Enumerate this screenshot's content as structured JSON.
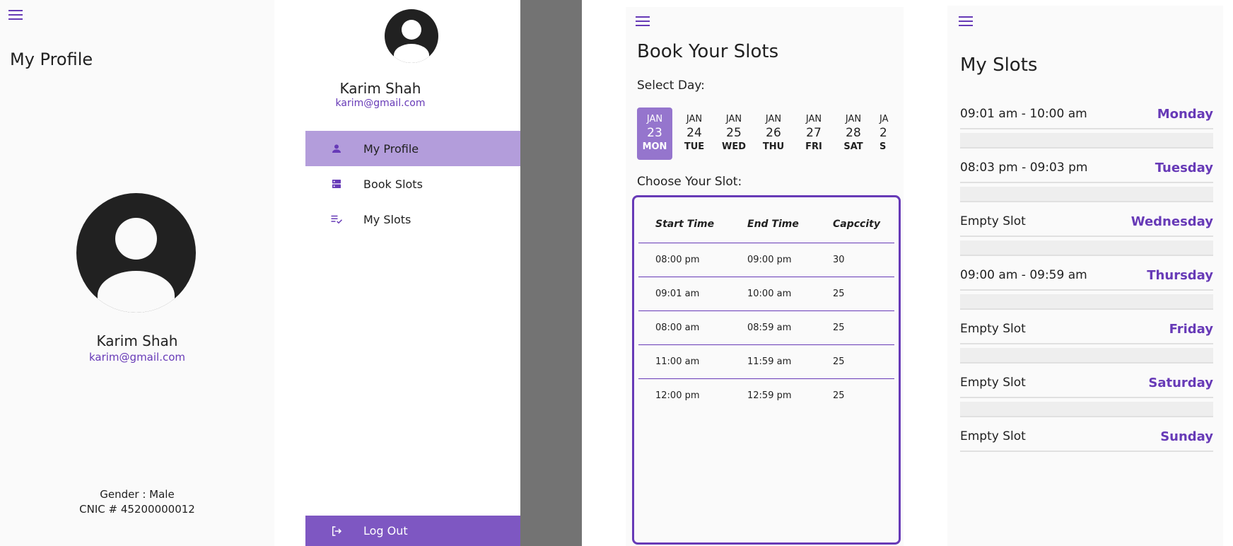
{
  "profile": {
    "title": "My Profile",
    "name": "Karim Shah",
    "email": "karim@gmail.com",
    "gender": "Gender : Male",
    "cnic": "CNIC # 45200000012"
  },
  "drawer": {
    "name": "Karim Shah",
    "email": "karim@gmail.com",
    "items": [
      {
        "label": "My Profile",
        "icon": "person-icon",
        "active": true
      },
      {
        "label": "Book Slots",
        "icon": "dns-icon",
        "active": false
      },
      {
        "label": "My Slots",
        "icon": "playlist-check-icon",
        "active": false
      }
    ],
    "logout": "Log Out"
  },
  "book": {
    "title": "Book Your Slots",
    "select_day": "Select Day:",
    "choose_slot": "Choose Your Slot:",
    "days": [
      {
        "month": "JAN",
        "date": "23",
        "weekday": "MON",
        "selected": true
      },
      {
        "month": "JAN",
        "date": "24",
        "weekday": "TUE"
      },
      {
        "month": "JAN",
        "date": "25",
        "weekday": "WED"
      },
      {
        "month": "JAN",
        "date": "26",
        "weekday": "THU"
      },
      {
        "month": "JAN",
        "date": "27",
        "weekday": "FRI"
      },
      {
        "month": "JAN",
        "date": "28",
        "weekday": "SAT"
      },
      {
        "month": "JA",
        "date": "2",
        "weekday": "S"
      }
    ],
    "columns": [
      "Start Time",
      "End Time",
      "Capccity"
    ],
    "rows": [
      [
        "08:00 pm",
        "09:00 pm",
        "30"
      ],
      [
        "09:01 am",
        "10:00 am",
        "25"
      ],
      [
        "08:00 am",
        "08:59 am",
        "25"
      ],
      [
        "11:00 am",
        "11:59 am",
        "25"
      ],
      [
        "12:00 pm",
        "12:59 pm",
        "25"
      ]
    ]
  },
  "myslots": {
    "title": "My Slots",
    "items": [
      {
        "time": "09:01 am - 10:00 am",
        "day": "Monday"
      },
      {
        "time": "08:03 pm - 09:03 pm",
        "day": "Tuesday"
      },
      {
        "time": "Empty Slot",
        "day": "Wednesday"
      },
      {
        "time": "09:00 am - 09:59 am",
        "day": "Thursday"
      },
      {
        "time": "Empty Slot",
        "day": "Friday"
      },
      {
        "time": "Empty Slot",
        "day": "Saturday"
      },
      {
        "time": "Empty Slot",
        "day": "Sunday"
      }
    ]
  },
  "colors": {
    "accent": "#673ab7",
    "accent_light": "#b39ddb",
    "logout_bg": "#7e57c2"
  }
}
